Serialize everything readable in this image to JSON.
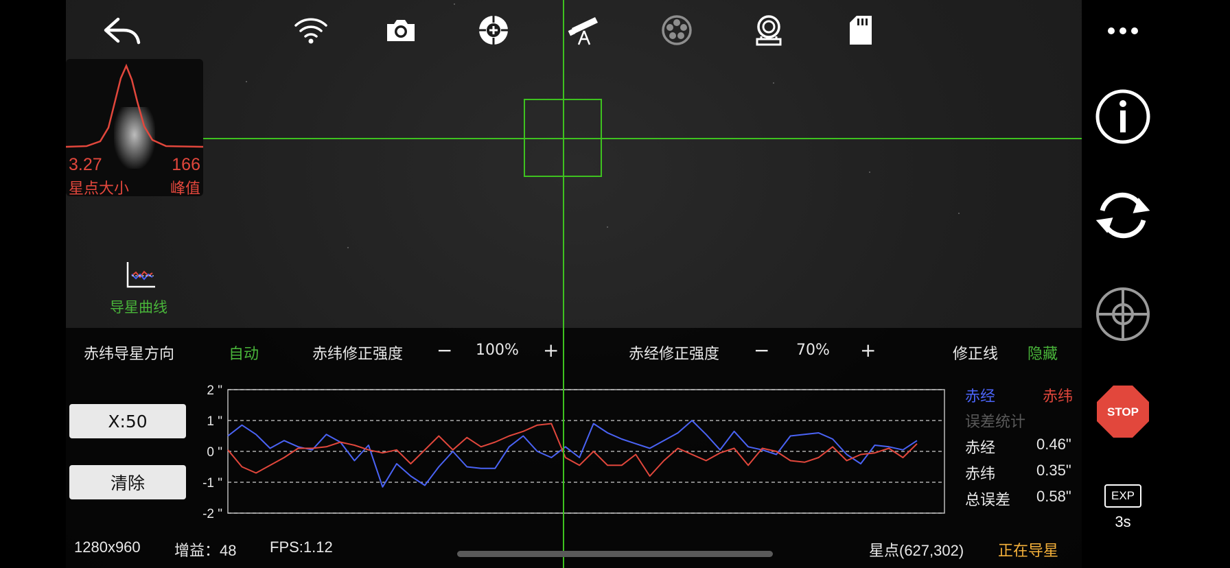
{
  "profile": {
    "star_size": "3.27",
    "star_size_label": "星点大小",
    "peak": "166",
    "peak_label": "峰值"
  },
  "guide_curve": {
    "label": "导星曲线"
  },
  "toolbar": {
    "icons": [
      "back-icon",
      "wifi-icon",
      "camera-icon",
      "focus-icon",
      "telescope-icon",
      "filter-wheel-icon",
      "guider-icon",
      "sd-card-icon"
    ]
  },
  "controls": {
    "dec_guide_dir_label": "赤纬导星方向",
    "dec_guide_dir_value": "自动",
    "dec_strength_label": "赤纬修正强度",
    "dec_strength_value": "100%",
    "ra_strength_label": "赤经修正强度",
    "ra_strength_value": "70%",
    "minus": "−",
    "plus": "+",
    "correction_line_label": "修正线",
    "correction_line_value": "隐藏"
  },
  "buttons": {
    "x_scale": "X:50",
    "clear": "清除"
  },
  "stats": {
    "legend_ra": "赤经",
    "legend_dec": "赤纬",
    "title": "误差统计",
    "ra_label": "赤经",
    "ra_value": "0.46\"",
    "dec_label": "赤纬",
    "dec_value": "0.35\"",
    "total_label": "总误差",
    "total_value": "0.58\""
  },
  "status": {
    "resolution": "1280x960",
    "gain": "增益：48",
    "fps": "FPS:1.12",
    "star_pos": "星点(627,302)",
    "state": "正在导星"
  },
  "sidebar": {
    "exp_label": "EXP",
    "exp_value": "3s",
    "stop_label": "STOP"
  },
  "colors": {
    "ra": "#4a63f5",
    "dec": "#e2473c",
    "green": "#3ec21f",
    "status_orange": "#f5b13a"
  },
  "chart_data": {
    "type": "line",
    "ylim": [
      -2,
      2
    ],
    "yticks": [
      "2 \"",
      "1 \"",
      "0 \"",
      "-1 \"",
      "-2 \""
    ],
    "x_count": 50,
    "series": [
      {
        "name": "赤经",
        "color": "#4a63f5",
        "values": [
          0.5,
          0.85,
          0.55,
          0.1,
          0.35,
          0.15,
          0.05,
          0.55,
          0.3,
          -0.3,
          0.2,
          -1.15,
          -0.4,
          -0.8,
          -1.1,
          -0.5,
          0.0,
          -0.5,
          -0.55,
          -0.55,
          0.15,
          0.5,
          0.0,
          -0.2,
          0.15,
          -0.2,
          0.9,
          0.6,
          0.4,
          0.25,
          0.1,
          0.35,
          0.6,
          1.0,
          0.55,
          0.05,
          0.65,
          0.15,
          0.05,
          -0.1,
          0.5,
          0.55,
          0.6,
          0.4,
          -0.1,
          -0.4,
          0.2,
          0.15,
          0.05,
          0.35
        ]
      },
      {
        "name": "赤纬",
        "color": "#e2473c",
        "values": [
          0.05,
          -0.5,
          -0.7,
          -0.45,
          -0.2,
          0.1,
          0.1,
          0.15,
          0.3,
          0.2,
          0.05,
          -0.05,
          0.05,
          -0.4,
          0.05,
          0.5,
          0.05,
          0.45,
          0.15,
          0.3,
          0.5,
          0.65,
          0.85,
          0.9,
          -0.2,
          -0.45,
          0.0,
          -0.45,
          -0.45,
          -0.1,
          -0.8,
          -0.3,
          0.1,
          -0.1,
          -0.3,
          -0.05,
          0.1,
          -0.45,
          0.1,
          0.0,
          -0.3,
          -0.35,
          -0.2,
          0.15,
          -0.3,
          -0.1,
          -0.05,
          0.1,
          -0.2,
          0.25
        ]
      }
    ]
  }
}
